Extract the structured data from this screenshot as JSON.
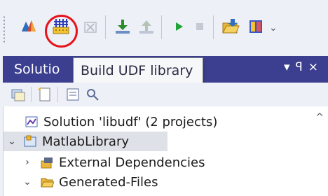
{
  "toolbar": {
    "buttons": [
      {
        "name": "matlab-import-icon"
      },
      {
        "name": "build-udf-library-icon"
      },
      {
        "name": "delete-icon"
      },
      {
        "name": "download-icon"
      },
      {
        "name": "upload-icon"
      },
      {
        "name": "play-icon"
      },
      {
        "name": "stop-icon"
      },
      {
        "name": "folder-open-icon"
      },
      {
        "name": "book-icon"
      }
    ],
    "highlight_color": "#e8141b"
  },
  "panel": {
    "title": "Solutio",
    "header_controls": "▾ ꟼ ×",
    "header_color": "#3c3f8f",
    "tooltip": "Build UDF library"
  },
  "tree": {
    "items": [
      {
        "label": "Solution 'libudf' (2 projects)",
        "chevron": "",
        "icon": "solution-icon"
      },
      {
        "label": "MatlabLibrary",
        "chevron": "⌄",
        "icon": "project-icon",
        "selected": true
      },
      {
        "label": "External Dependencies",
        "chevron": "›",
        "icon": "dependencies-icon"
      },
      {
        "label": "Generated-Files",
        "chevron": "⌄",
        "icon": "folder-icon"
      }
    ]
  }
}
